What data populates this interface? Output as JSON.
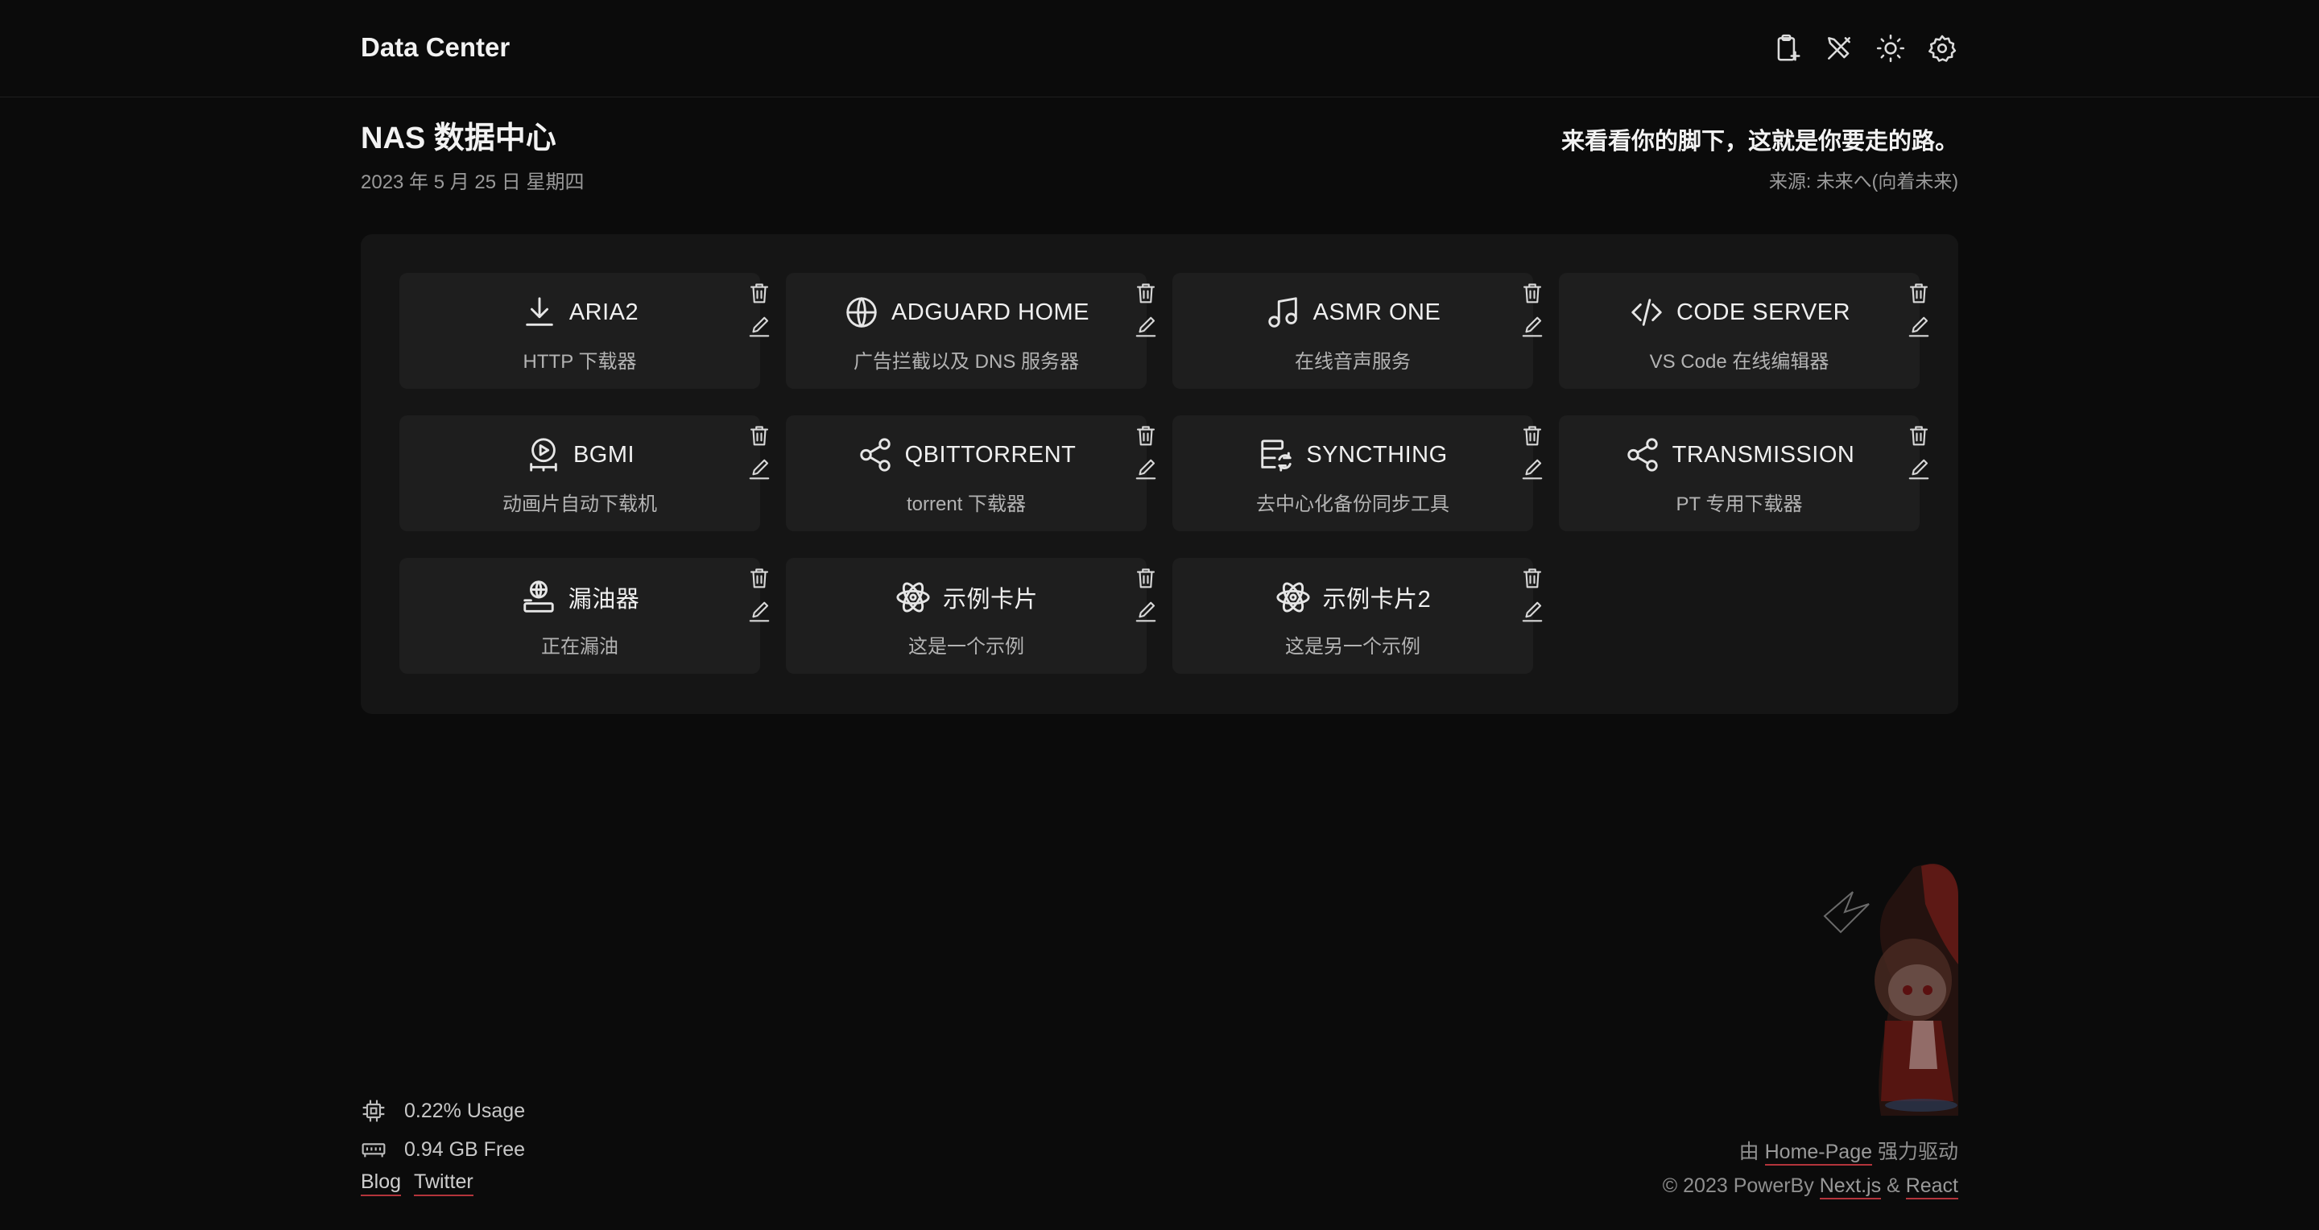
{
  "header": {
    "title": "Data Center"
  },
  "toolbar": [
    {
      "name": "clipboard-add-icon"
    },
    {
      "name": "tools-icon"
    },
    {
      "name": "sun-icon"
    },
    {
      "name": "gear-icon"
    }
  ],
  "page": {
    "title": "NAS 数据中心",
    "date": "2023 年 5 月 25 日 星期四"
  },
  "quote": {
    "text": "来看看你的脚下，这就是你要走的路。",
    "source": "来源: 未来へ(向着未来)"
  },
  "cards": [
    {
      "title": "ARIA2",
      "desc": "HTTP 下载器",
      "icon": "download-icon"
    },
    {
      "title": "ADGUARD HOME",
      "desc": "广告拦截以及 DNS 服务器",
      "icon": "globe-icon"
    },
    {
      "title": "ASMR ONE",
      "desc": "在线音声服务",
      "icon": "music-icon"
    },
    {
      "title": "CODE SERVER",
      "desc": "VS Code 在线编辑器",
      "icon": "code-icon"
    },
    {
      "title": "BGMI",
      "desc": "动画片自动下载机",
      "icon": "video-play-icon"
    },
    {
      "title": "QBITTORRENT",
      "desc": "torrent 下载器",
      "icon": "share-icon"
    },
    {
      "title": "SYNCTHING",
      "desc": "去中心化备份同步工具",
      "icon": "server-sync-icon"
    },
    {
      "title": "TRANSMISSION",
      "desc": "PT 专用下载器",
      "icon": "share-icon"
    },
    {
      "title": "漏油器",
      "desc": "正在漏油",
      "icon": "globe-stand-icon"
    },
    {
      "title": "示例卡片",
      "desc": "这是一个示例",
      "icon": "react-icon"
    },
    {
      "title": "示例卡片2",
      "desc": "这是另一个示例",
      "icon": "react-icon"
    }
  ],
  "stats": {
    "cpu": "0.22% Usage",
    "memory": "0.94 GB Free"
  },
  "links": {
    "blog": "Blog",
    "twitter": "Twitter"
  },
  "credits": {
    "prefix": "由",
    "homepage": "Home-Page",
    "suffix": "强力驱动",
    "copyright": "© 2023 PowerBy",
    "nextjs": "Next.js",
    "amp": "&",
    "react": "React"
  }
}
